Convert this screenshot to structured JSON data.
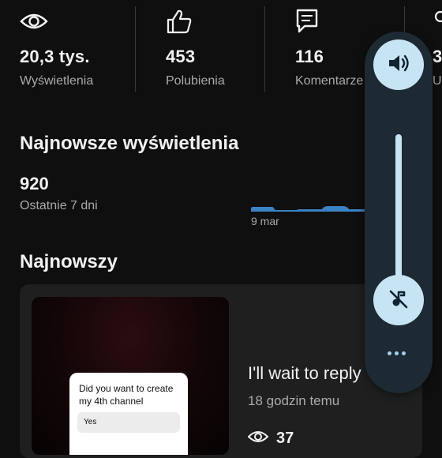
{
  "stats": [
    {
      "icon": "eye-icon",
      "value": "20,3 tys.",
      "label": "Wyświetlenia"
    },
    {
      "icon": "thumbs-up-icon",
      "value": "453",
      "label": "Polubienia"
    },
    {
      "icon": "comment-icon",
      "value": "116",
      "label": "Komentarze"
    },
    {
      "icon": "subscribers-icon",
      "value": "3",
      "label": "U"
    }
  ],
  "recent": {
    "title": "Najnowsze wyświetlenia",
    "count": "920",
    "period": "Ostatnie 7 dni",
    "chart_date": "9 mar"
  },
  "latest": {
    "title": "Najnowszy",
    "poll_question": "Did you want to create my 4th channel",
    "poll_option": "Yes",
    "video_title": "I'll wait to reply",
    "video_time": "18 godzin temu",
    "video_views": "37"
  },
  "volume_panel": {
    "speaker_icon": "speaker-icon",
    "mute_icon": "music-off-icon",
    "more_icon": "more-icon",
    "level": 0
  },
  "colors": {
    "background": "#0f0f0f",
    "panel": "#1d2a33",
    "panel_button": "#c7e4f4",
    "chart_blue": "#3b82c4"
  }
}
